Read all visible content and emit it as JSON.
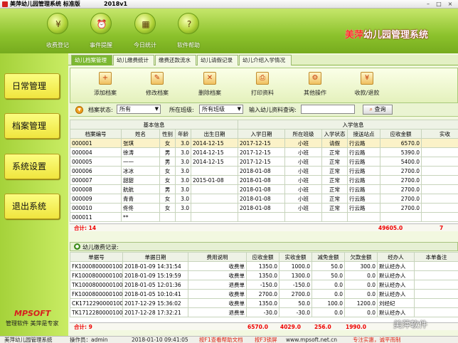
{
  "window": {
    "title": "美萍幼儿园管理系统 标准版",
    "version": "2018v1",
    "controls": {
      "minimize": "–",
      "maximize": "□",
      "close": "×"
    }
  },
  "toolbar": [
    {
      "label": "收费登记",
      "icon": "cash-register-icon",
      "glyph": "¥"
    },
    {
      "label": "事件提醒",
      "icon": "alarm-clock-icon",
      "glyph": "⏰"
    },
    {
      "label": "今日统计",
      "icon": "calendar-icon",
      "glyph": "▦"
    },
    {
      "label": "软件帮助",
      "icon": "help-icon",
      "glyph": "?"
    }
  ],
  "brand": {
    "prefix": "美萍",
    "suffix": "幼儿园管理系统"
  },
  "sidebar": {
    "items": [
      "日常管理",
      "档案管理",
      "系统设置",
      "退出系统"
    ],
    "logo": "MPSOFT",
    "tagline": "管理软件  美萍是专家"
  },
  "tabs": [
    "幼儿档案管理",
    "幼儿缴费统计",
    "缴费还款流水",
    "幼儿请假记录",
    "幼儿介绍入学情况"
  ],
  "actions": [
    {
      "label": "添加档案",
      "glyph": "+"
    },
    {
      "label": "修改档案",
      "glyph": "✎"
    },
    {
      "label": "删除档案",
      "glyph": "✕"
    },
    {
      "label": "打印资料",
      "glyph": "⎙"
    },
    {
      "label": "其他操作",
      "glyph": "⚙"
    },
    {
      "label": "收款/退款",
      "glyph": "¥"
    }
  ],
  "filters": {
    "status_label": "档案状态:",
    "status_value": "所有",
    "class_label": "所在班级:",
    "class_value": "所有班级",
    "search_label": "输入幼儿资料查询:",
    "search_value": "",
    "search_button": "查询"
  },
  "table1": {
    "group_headers": [
      "基本信息",
      "入学信息"
    ],
    "columns": [
      "档案编号",
      "姓名",
      "性别",
      "年龄",
      "出生日期",
      "入学日期",
      "所在班级",
      "入学状态",
      "接送站点",
      "应收金额",
      "实收"
    ],
    "rows": [
      [
        "000001",
        "张琪",
        "女",
        "3.0",
        "2014-12-15",
        "2017-12-15",
        "小班",
        "请假",
        "行云路",
        "6570.0",
        "8"
      ],
      [
        "000004",
        "徐涛",
        "男",
        "3.0",
        "2014-12-15",
        "2017-12-15",
        "小班",
        "正常",
        "行云路",
        "5390.0",
        "5"
      ],
      [
        "000005",
        "一一",
        "男",
        "3.0",
        "2014-12-15",
        "2017-12-15",
        "小班",
        "正常",
        "行云路",
        "5400.0",
        "5"
      ],
      [
        "000006",
        "冰冰",
        "女",
        "3.0",
        "",
        "2018-01-08",
        "小班",
        "正常",
        "行云路",
        "2700.0",
        "2"
      ],
      [
        "000007",
        "甜甜",
        "女",
        "3.0",
        "2015-01-08",
        "2018-01-08",
        "小班",
        "正常",
        "行云路",
        "2700.0",
        "2"
      ],
      [
        "000008",
        "航航",
        "男",
        "3.0",
        "",
        "2018-01-08",
        "小班",
        "正常",
        "行云路",
        "2700.0",
        "2"
      ],
      [
        "000009",
        "青青",
        "女",
        "3.0",
        "",
        "2018-01-08",
        "小班",
        "正常",
        "行云路",
        "2700.0",
        "2"
      ],
      [
        "000010",
        "佟佟",
        "女",
        "3.0",
        "",
        "2018-01-08",
        "小班",
        "正常",
        "行云路",
        "2700.0",
        "2"
      ],
      [
        "000011",
        "**",
        "",
        "",
        "",
        "",
        "",
        "",
        "",
        "",
        ""
      ]
    ],
    "footer_label": "合计: 14",
    "footer_total": "49605.0",
    "footer_extra": "7"
  },
  "section2": {
    "title": "幼儿缴费记录:"
  },
  "table2": {
    "columns": [
      "单据号",
      "单据日期",
      "费用说明",
      "应收金额",
      "实收金额",
      "减免金额",
      "欠款金额",
      "经办人",
      "本单备注"
    ],
    "rows": [
      [
        "FK100080000010000",
        "2018-01-09 14:31:54",
        "收费单",
        "1350.0",
        "1000.0",
        "50.0",
        "300.0",
        "默认经办人",
        ""
      ],
      [
        "FK100080000010000",
        "2018-01-09 15:19:59",
        "收费单",
        "1350.0",
        "1300.0",
        "50.0",
        "0.0",
        "默认经办人",
        ""
      ],
      [
        "TK100080000010000",
        "2018-01-05 12:01:36",
        "退费单",
        "-150.0",
        "-150.0",
        "0.0",
        "0.0",
        "默认经办人",
        ""
      ],
      [
        "FK100080000010000",
        "2018-01-05 10:10:41",
        "收费单",
        "2700.0",
        "2700.0",
        "0.0",
        "0.0",
        "默认经办人",
        ""
      ],
      [
        "CK171229000010000",
        "2017-12-29 15:36:02",
        "收费单",
        "1350.0",
        "50.0",
        "100.0",
        "1200.0",
        "刘经纪",
        ""
      ],
      [
        "TK171228000010000",
        "2017-12-28 17:32:21",
        "退费单",
        "-30.0",
        "-30.0",
        "0.0",
        "0.0",
        "默认经办人",
        ""
      ]
    ],
    "footer_label": "合计: 9",
    "footer_receivable": "6570.0",
    "footer_received": "4029.0",
    "footer_discount": "256.0",
    "footer_debt": "1990.0"
  },
  "statusbar": {
    "system": "美萍幼儿园管理系统",
    "operator": "操作员：admin",
    "datetime": "2018-01-10 09:41:05",
    "help": "按F1查看帮助文档",
    "f3": "按F3锁屏",
    "website": "www.mpsoft.net.cn",
    "slogan": "专注实惠，诚平而制"
  },
  "watermark": "美萍软件"
}
